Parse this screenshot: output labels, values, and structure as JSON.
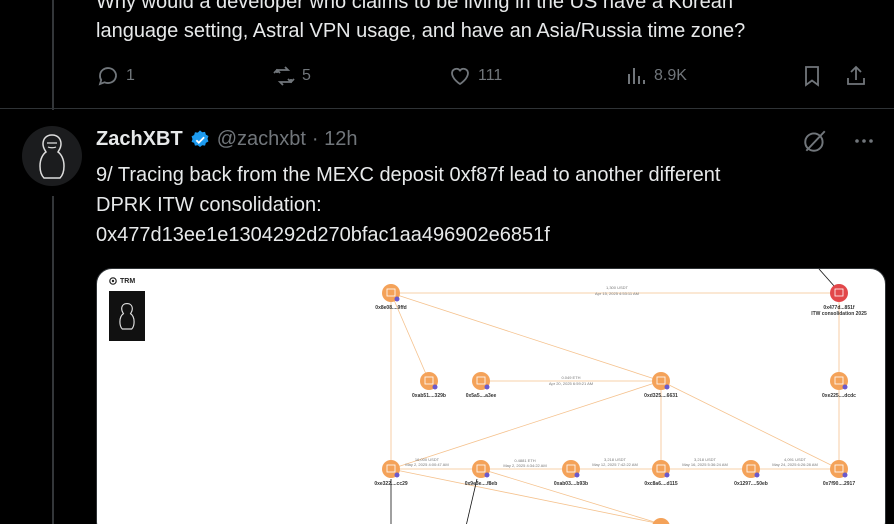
{
  "prev_tweet": {
    "text_line1": "Why would a developer who claims to be living in the US have a Korean",
    "text_line2": "language setting, Astral VPN usage, and have an Asia/Russia time zone?",
    "replies": "1",
    "reposts": "5",
    "likes": "111",
    "views": "8.9K"
  },
  "tweet": {
    "name": "ZachXBT",
    "handle": "@zachxbt",
    "time": "· 12h",
    "text_line1": "9/ Tracing back from the MEXC deposit 0xf87f lead to another different",
    "text_line2": "DPRK ITW consolidation:",
    "text_line3": "0x477d13ee1e1304292d270bfac1aa496902e6851f"
  },
  "media": {
    "brand": "TRM",
    "nodes": [
      {
        "label": "0x8e08....9ffd"
      },
      {
        "label": "0x477d...851f"
      },
      {
        "label": "ITW consolidation 2025"
      },
      {
        "label": "0xab51....329b"
      },
      {
        "label": "0x5a5....a3ee"
      },
      {
        "label": "0xd325....6631"
      },
      {
        "label": "0xe225....dcdc"
      },
      {
        "label": "0xe322....cc29"
      },
      {
        "label": "0x9e3e....f8eb"
      },
      {
        "label": "0xab03....b93b"
      },
      {
        "label": "0xc8a6....d115"
      },
      {
        "label": "0x1297....50eb"
      },
      {
        "label": "0x7f90....2917"
      }
    ],
    "edges": [
      {
        "label": "1,300 USDT"
      },
      {
        "label": "Apr 15, 2025 4:53:11 AM"
      },
      {
        "label": "0.049 ETH"
      },
      {
        "label": "Apr 20, 2025 6:59:21 AM"
      },
      {
        "label": "16,000 USDT"
      },
      {
        "label": "May 2, 2025 4:00:47 AM"
      },
      {
        "label": "0.4881 ETH"
      },
      {
        "label": "May 2, 2025 4:34:22 AM"
      },
      {
        "label": "3,218 USDT"
      },
      {
        "label": "May 12, 2025 7:42:22 AM"
      },
      {
        "label": "3,218 USDT"
      },
      {
        "label": "May 16, 2025 5:36:24 AM"
      },
      {
        "label": "4,091 USDT"
      },
      {
        "label": "May 24, 2025 6:26:28 AM"
      }
    ]
  },
  "colors": {
    "node": "#f4a259",
    "node_red": "#e2474a",
    "edge": "#f5c28e",
    "accent": "#1d9bf0"
  }
}
